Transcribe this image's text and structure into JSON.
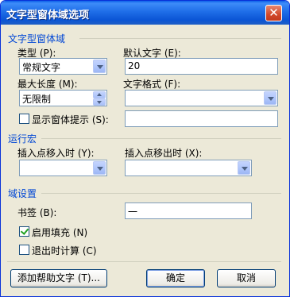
{
  "window": {
    "title": "文字型窗体域选项",
    "close_icon": "close-icon"
  },
  "section_text_field": {
    "heading": "文字型窗体域",
    "type": {
      "label": "类型 (P):",
      "value": "常规文字"
    },
    "default_text": {
      "label": "默认文字 (E):",
      "value": "20"
    },
    "max_length": {
      "label": "最大长度 (M):",
      "value": "无限制"
    },
    "text_format": {
      "label": "文字格式 (F):",
      "value": ""
    },
    "show_hint": {
      "label": "显示窗体提示 (S):",
      "checked": false,
      "value": ""
    }
  },
  "section_macro": {
    "heading": "运行宏",
    "entry": {
      "label": "插入点移入时 (Y):",
      "value": ""
    },
    "exit": {
      "label": "插入点移出时 (X):",
      "value": ""
    }
  },
  "section_field_settings": {
    "heading": "域设置",
    "bookmark": {
      "label": "书签 (B):",
      "value": "一"
    },
    "enable_fill": {
      "label": "启用填充 (N)",
      "checked": true
    },
    "calc_on_exit": {
      "label": "退出时计算 (C)",
      "checked": false
    }
  },
  "buttons": {
    "help_text": "添加帮助文字 (T)...",
    "ok": "确定",
    "cancel": "取消"
  }
}
